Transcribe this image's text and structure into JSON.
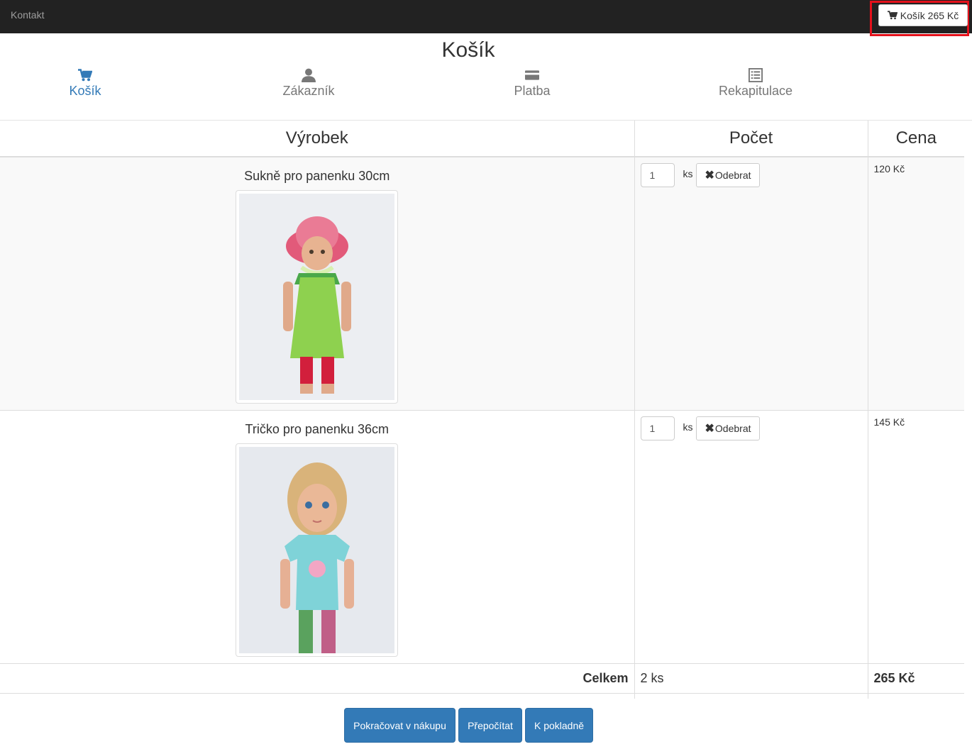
{
  "navbar": {
    "contact": "Kontakt",
    "cart_button": "Košík 265 Kč"
  },
  "page_title": "Košík",
  "steps": [
    {
      "label": "Košík",
      "icon": "cart-icon",
      "active": true
    },
    {
      "label": "Zákazník",
      "icon": "user-icon",
      "active": false
    },
    {
      "label": "Platba",
      "icon": "credit-card-icon",
      "active": false
    },
    {
      "label": "Rekapitulace",
      "icon": "list-icon",
      "active": false
    }
  ],
  "table": {
    "headers": {
      "product": "Výrobek",
      "quantity": "Počet",
      "price": "Cena"
    },
    "items": [
      {
        "name": "Sukně pro panenku 30cm",
        "qty": "1",
        "unit": "ks",
        "remove": "Odebrat",
        "price": "120 Kč",
        "image": "doll-green-dress-photo"
      },
      {
        "name": "Tričko pro panenku 36cm",
        "qty": "1",
        "unit": "ks",
        "remove": "Odebrat",
        "price": "145 Kč",
        "image": "doll-blue-shirt-photo"
      }
    ],
    "total": {
      "label": "Celkem",
      "quantity": "2 ks",
      "price": "265 Kč"
    }
  },
  "actions": {
    "continue": "Pokračovat v nákupu",
    "recalculate": "Přepočítat",
    "checkout": "K pokladně"
  },
  "colors": {
    "primary": "#337ab7",
    "navbar": "#222222",
    "highlight": "#e4111b"
  }
}
